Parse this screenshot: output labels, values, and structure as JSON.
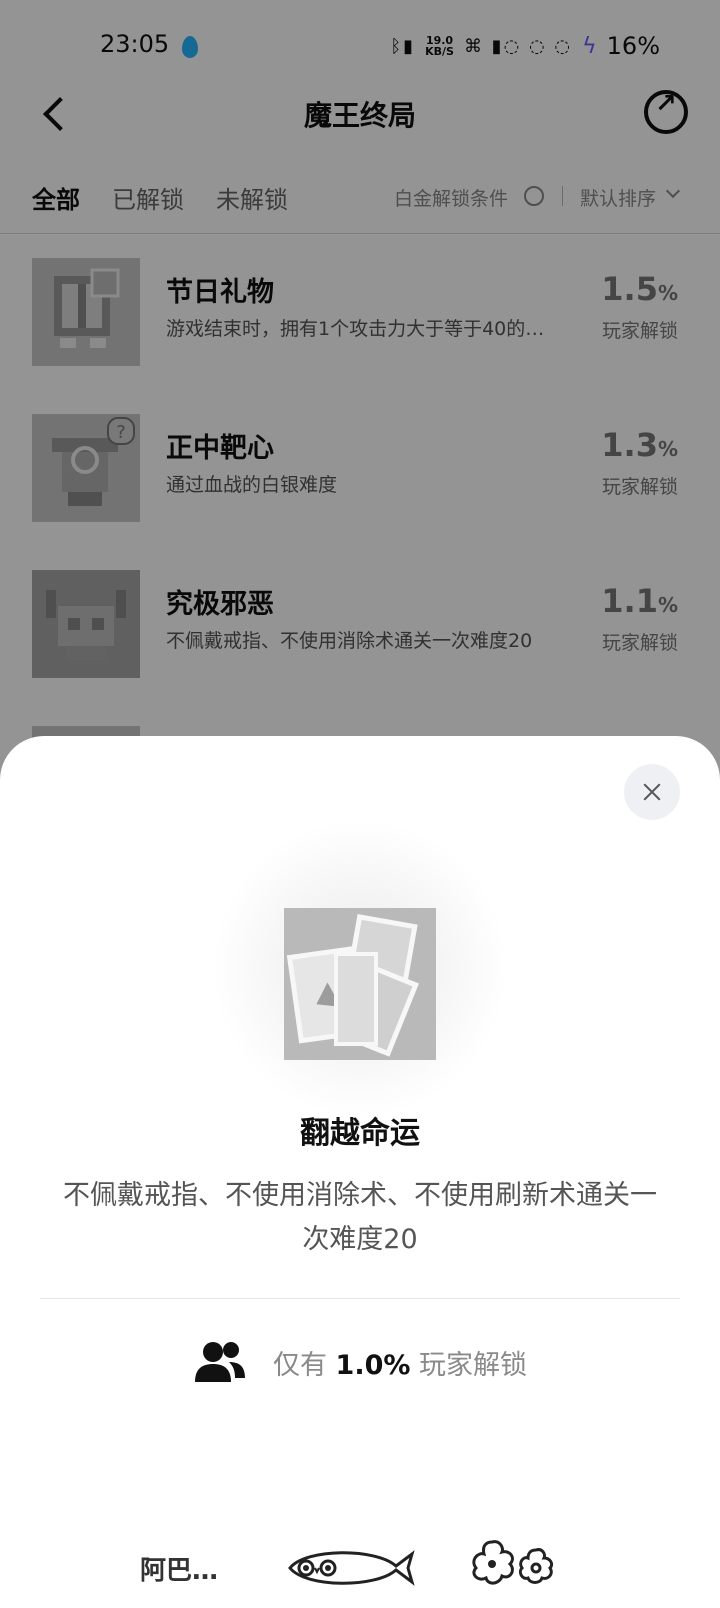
{
  "status_bar": {
    "time": "23:05",
    "net_speed_value": "19.0",
    "net_speed_unit": "KB/S",
    "battery": "16%"
  },
  "nav": {
    "title": "魔王终局"
  },
  "filters": {
    "tabs": [
      "全部",
      "已解锁",
      "未解锁"
    ],
    "active_tab": "全部",
    "platinum_condition": "白金解锁条件",
    "sort_label": "默认排序"
  },
  "achievements": [
    {
      "name": "节日礼物",
      "desc": "游戏结束时，拥有1个攻击力大于等于40的…",
      "percent": "1.5",
      "percent_unit": "%",
      "percent_label": "玩家解锁"
    },
    {
      "name": "正中靶心",
      "desc": "通过血战的白银难度",
      "percent": "1.3",
      "percent_unit": "%",
      "percent_label": "玩家解锁"
    },
    {
      "name": "究极邪恶",
      "desc": "不佩戴戒指、不使用消除术通关一次难度20",
      "percent": "1.1",
      "percent_unit": "%",
      "percent_label": "玩家解锁"
    }
  ],
  "sheet": {
    "title": "翻越命运",
    "desc": "不佩戴戒指、不使用消除术、不使用刷新术通关一次难度20",
    "rate_prefix": "仅有",
    "rate_value": "1.0%",
    "rate_suffix": "玩家解锁"
  },
  "decoration": {
    "text": "阿巴…"
  },
  "colors": {
    "accent_blue": "#25b6ff",
    "bolt": "#6a5cff"
  }
}
